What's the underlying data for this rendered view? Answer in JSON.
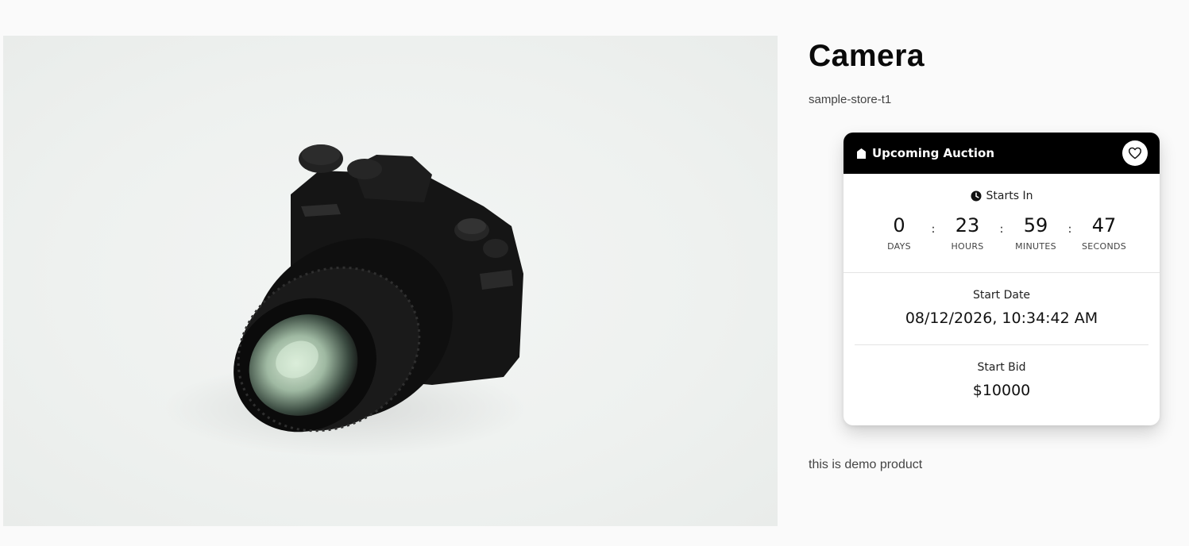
{
  "product": {
    "title": "Camera",
    "store": "sample-store-t1",
    "description": "this is demo product",
    "image_alt": "camera-photo"
  },
  "auction": {
    "header_label": "Upcoming Auction",
    "starts_in_label": "Starts In",
    "countdown": [
      {
        "value": "0",
        "label": "DAYS"
      },
      {
        "value": "23",
        "label": "HOURS"
      },
      {
        "value": "59",
        "label": "MINUTES"
      },
      {
        "value": "47",
        "label": "SECONDS"
      }
    ],
    "separator": ":",
    "start_date_label": "Start Date",
    "start_date_value": "08/12/2026, 10:34:42 AM",
    "start_bid_label": "Start Bid",
    "start_bid_value": "$10000"
  },
  "icons": {
    "header": "tag-icon",
    "favorite": "heart-icon",
    "clock": "clock-icon"
  },
  "colors": {
    "header_bg": "#000000",
    "card_bg": "#ffffff",
    "page_bg": "#fafafa"
  }
}
